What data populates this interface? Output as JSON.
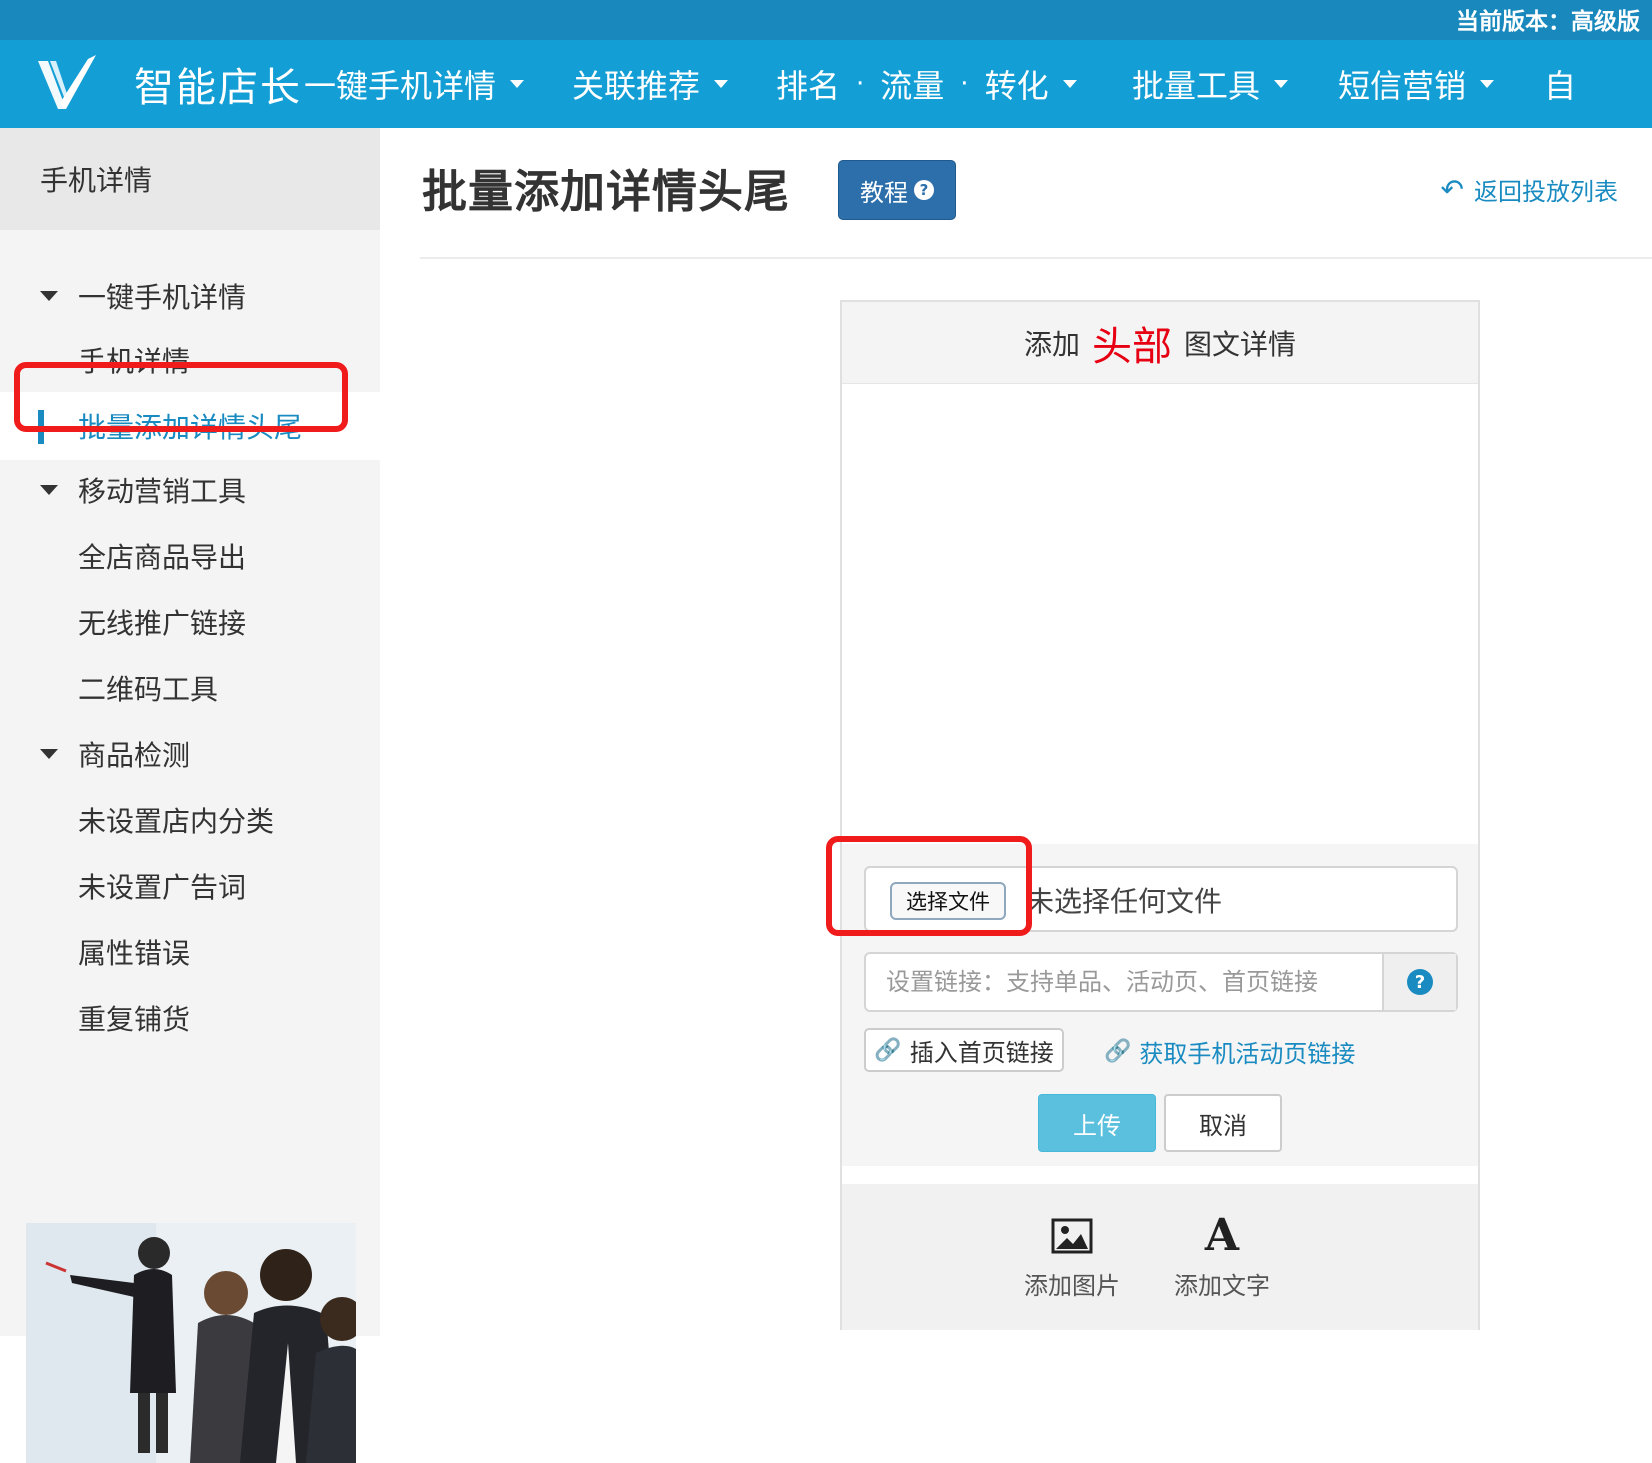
{
  "header": {
    "version_label": "当前版本：高级版",
    "brand_name": "智能店长",
    "nav": [
      {
        "label": "一键手机详情"
      },
      {
        "label": "关联推荐"
      },
      {
        "label": "排名"
      },
      {
        "label": "流量"
      },
      {
        "label": "转化"
      },
      {
        "label": "批量工具"
      },
      {
        "label": "短信营销"
      },
      {
        "label": "自"
      }
    ],
    "nav_separator": "·"
  },
  "sidebar": {
    "title": "手机详情",
    "items": [
      {
        "label": "一键手机详情",
        "type": "group"
      },
      {
        "label": "手机详情",
        "type": "sub"
      },
      {
        "label": "批量添加详情头尾",
        "type": "sub",
        "active": true
      },
      {
        "label": "移动营销工具",
        "type": "group"
      },
      {
        "label": "全店商品导出",
        "type": "sub"
      },
      {
        "label": "无线推广链接",
        "type": "sub"
      },
      {
        "label": "二维码工具",
        "type": "sub"
      },
      {
        "label": "商品检测",
        "type": "group"
      },
      {
        "label": "未设置店内分类",
        "type": "sub"
      },
      {
        "label": "未设置广告词",
        "type": "sub"
      },
      {
        "label": "属性错误",
        "type": "sub"
      },
      {
        "label": "重复铺货",
        "type": "sub"
      }
    ]
  },
  "main": {
    "title": "批量添加详情头尾",
    "tutorial_label": "教程",
    "back_label": "返回投放列表",
    "panel": {
      "head_prefix": "添加",
      "head_emphasis": "头部",
      "head_suffix": "图文详情",
      "file_button_label": "选择文件",
      "file_status": "未选择任何文件",
      "link_placeholder": "设置链接：支持单品、活动页、首页链接",
      "insert_home_label": "插入首页链接",
      "get_activity_label": "获取手机活动页链接",
      "upload_label": "上传",
      "cancel_label": "取消",
      "add_image_label": "添加图片",
      "add_text_label": "添加文字"
    }
  },
  "colors": {
    "topstrip": "#1888bd",
    "navbar": "#139fd5",
    "accent": "#1a8bc1",
    "tutorial_button": "#2c6faa",
    "upload_button": "#5bc0de",
    "highlight_box": "#f01b1b",
    "head_emphasis": "#e60012"
  }
}
